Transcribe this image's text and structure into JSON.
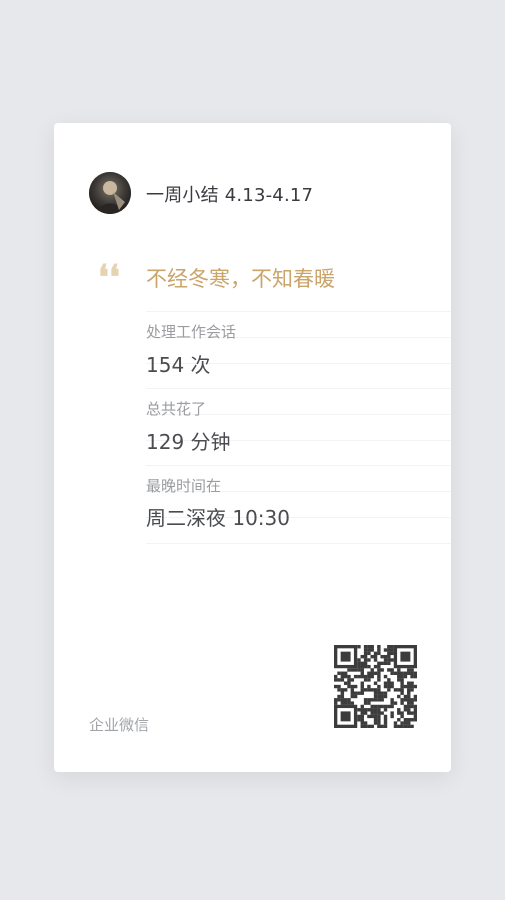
{
  "card": {
    "title": "一周小结 4.13-4.17",
    "quote_mark": "❛❛",
    "headline": "不经冬寒，不知春暖",
    "stats": [
      {
        "label": "处理工作会话",
        "value": "154 次"
      },
      {
        "label": "总共花了",
        "value": "129 分钟"
      },
      {
        "label": "最晚时间在",
        "value": "周二深夜 10:30"
      }
    ],
    "brand": "企业微信",
    "icons": {
      "avatar": "user-avatar",
      "qr": "qr-code-icon",
      "quote": "quote-icon"
    },
    "colors": {
      "background": "#e7e8ec",
      "card": "#ffffff",
      "headline": "#c9a56a",
      "quote": "#e6d3b0",
      "title": "#383b40",
      "label": "#9a9ca0",
      "value": "#4a4c50",
      "qr": "#3c3c3c"
    }
  }
}
